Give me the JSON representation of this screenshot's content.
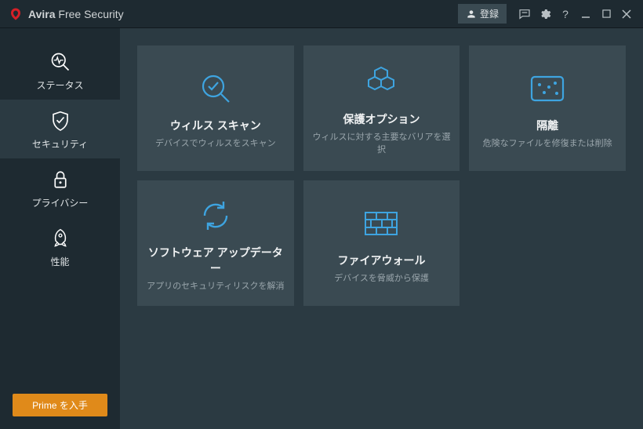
{
  "titlebar": {
    "brand": "Avira",
    "product": "Free Security",
    "login_label": "登録"
  },
  "sidebar": {
    "items": [
      {
        "id": "status",
        "label": "ステータス"
      },
      {
        "id": "security",
        "label": "セキュリティ"
      },
      {
        "id": "privacy",
        "label": "プライバシー"
      },
      {
        "id": "performance",
        "label": "性能"
      }
    ],
    "prime_label": "Prime を入手"
  },
  "tiles": [
    {
      "id": "virus-scan",
      "title": "ウィルス スキャン",
      "desc": "デバイスでウィルスをスキャン"
    },
    {
      "id": "protection-options",
      "title": "保護オプション",
      "desc": "ウィルスに対する主要なバリアを選択"
    },
    {
      "id": "quarantine",
      "title": "隔離",
      "desc": "危険なファイルを修復または削除"
    },
    {
      "id": "software-updater",
      "title": "ソフトウェア アップデーター",
      "desc": "アプリのセキュリティリスクを解消"
    },
    {
      "id": "firewall",
      "title": "ファイアウォール",
      "desc": "デバイスを脅威から保護"
    }
  ],
  "colors": {
    "accent": "#3ea4e0",
    "prime": "#e08a1a",
    "logo": "#d62027"
  }
}
